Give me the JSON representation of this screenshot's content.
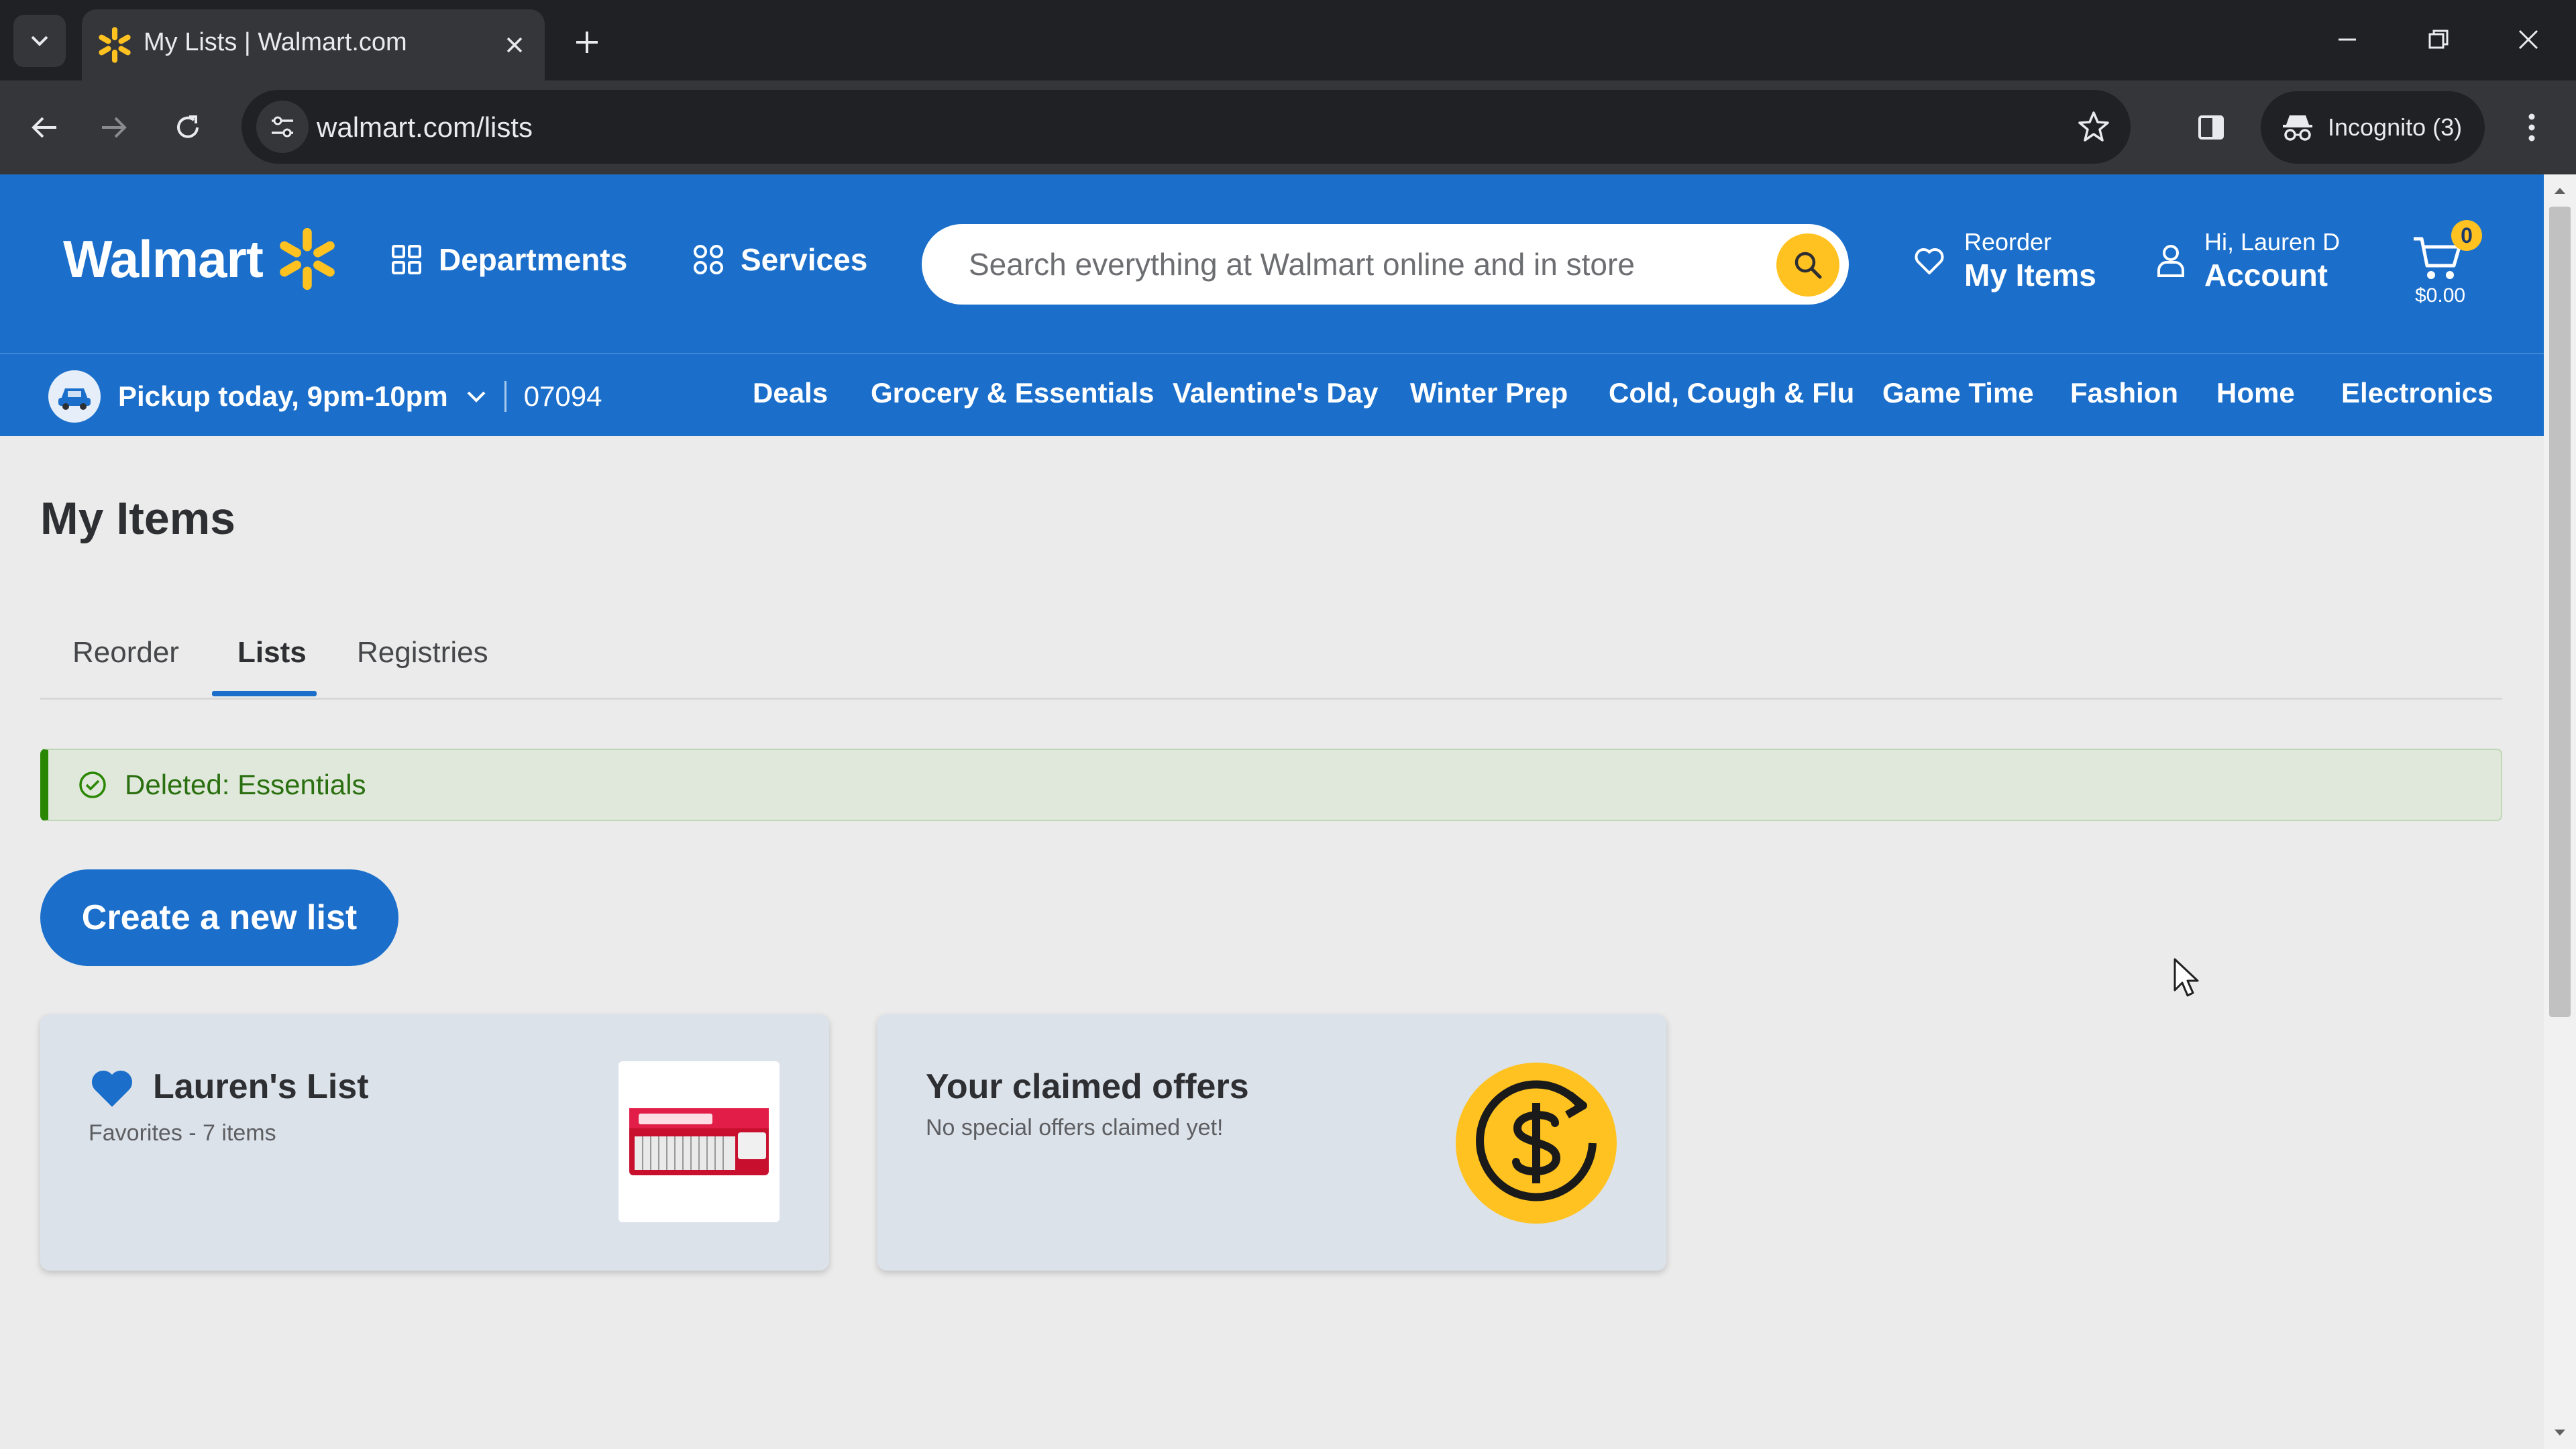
{
  "browser": {
    "tab_title": "My Lists | Walmart.com",
    "url": "walmart.com/lists",
    "incognito_label": "Incognito (3)"
  },
  "header": {
    "logo_text": "Walmart",
    "departments_label": "Departments",
    "services_label": "Services",
    "search_placeholder": "Search everything at Walmart online and in store",
    "reorder_small": "Reorder",
    "reorder_big": "My Items",
    "account_small": "Hi, Lauren D",
    "account_big": "Account",
    "cart_count": "0",
    "cart_total": "$0.00"
  },
  "subnav": {
    "pickup_text": "Pickup today, 9pm-10pm",
    "zip": "07094",
    "links": [
      "Deals",
      "Grocery & Essentials",
      "Valentine's Day",
      "Winter Prep",
      "Cold, Cough & Flu",
      "Game Time",
      "Fashion",
      "Home",
      "Electronics"
    ]
  },
  "page": {
    "title": "My Items",
    "tabs": [
      "Reorder",
      "Lists",
      "Registries"
    ],
    "active_tab": "Lists",
    "alert_text": "Deleted: Essentials",
    "create_button": "Create a new list"
  },
  "cards": {
    "list": {
      "title": "Lauren's List",
      "subtitle": "Favorites - 7 items"
    },
    "offers": {
      "title": "Your claimed offers",
      "subtitle": "No special offers claimed yet!"
    }
  },
  "colors": {
    "walmart_blue": "#1b6fcb",
    "spark_yellow": "#ffc220",
    "success_green": "#2a8703"
  },
  "icons": [
    "spark-icon",
    "grid-icon",
    "search-icon",
    "heart-icon",
    "user-icon",
    "cart-icon",
    "car-icon",
    "check-circle-icon",
    "dollar-coin-icon"
  ]
}
